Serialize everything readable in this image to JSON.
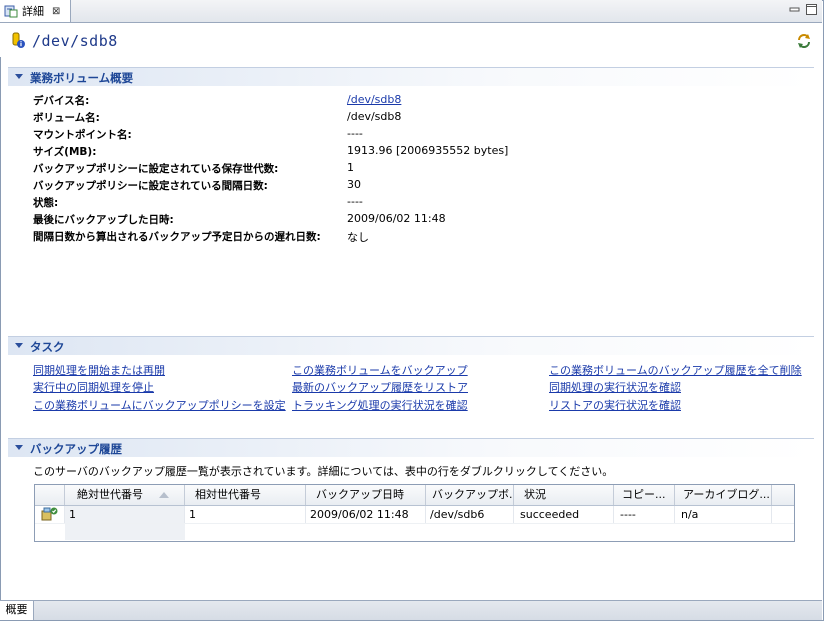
{
  "tab": {
    "label": "詳細",
    "close": "⊠"
  },
  "header": {
    "title": "/dev/sdb8"
  },
  "overview": {
    "title": "業務ボリューム概要",
    "rows": [
      {
        "label": "デバイス名:",
        "value": "/dev/sdb8"
      },
      {
        "label": "ボリューム名:",
        "value": "/dev/sdb8"
      },
      {
        "label": "マウントポイント名:",
        "value": "----"
      },
      {
        "label": "サイズ(MB):",
        "value": "1913.96 [2006935552 bytes]"
      },
      {
        "label": "バックアップポリシーに設定されている保存世代数:",
        "value": "1"
      },
      {
        "label": "バックアップポリシーに設定されている間隔日数:",
        "value": "30"
      },
      {
        "label": "状態:",
        "value": "----"
      },
      {
        "label": "最後にバックアップした日時:",
        "value": "2009/06/02 11:48"
      },
      {
        "label": "間隔日数から算出されるバックアップ予定日からの遅れ日数:",
        "value": "なし"
      }
    ]
  },
  "tasks": {
    "title": "タスク",
    "links": [
      "同期処理を開始または再開",
      "実行中の同期処理を停止",
      "この業務ボリュームにバックアップポリシーを設定",
      "この業務ボリュームをバックアップ",
      "最新のバックアップ履歴をリストア",
      "トラッキング処理の実行状況を確認",
      "この業務ボリュームのバックアップ履歴を全て削除",
      "同期処理の実行状況を確認",
      "リストアの実行状況を確認"
    ]
  },
  "history": {
    "title": "バックアップ履歴",
    "description": "このサーバのバックアップ履歴一覧が表示されています。詳細については、表中の行をダブルクリックしてください。",
    "columns": [
      "絶対世代番号",
      "相対世代番号",
      "バックアップ日時",
      "バックアップボ...",
      "状況",
      "コピー...",
      "アーカイブログ..."
    ],
    "rows": [
      [
        "1",
        "1",
        "2009/06/02 11:48",
        "/dev/sdb6",
        "succeeded",
        "----",
        "n/a"
      ]
    ]
  },
  "bottom_tab": {
    "label": "概要"
  },
  "colors": {
    "accent": "#1e4797",
    "link": "#1a3aaa",
    "section_bg": "#dde6f3"
  }
}
